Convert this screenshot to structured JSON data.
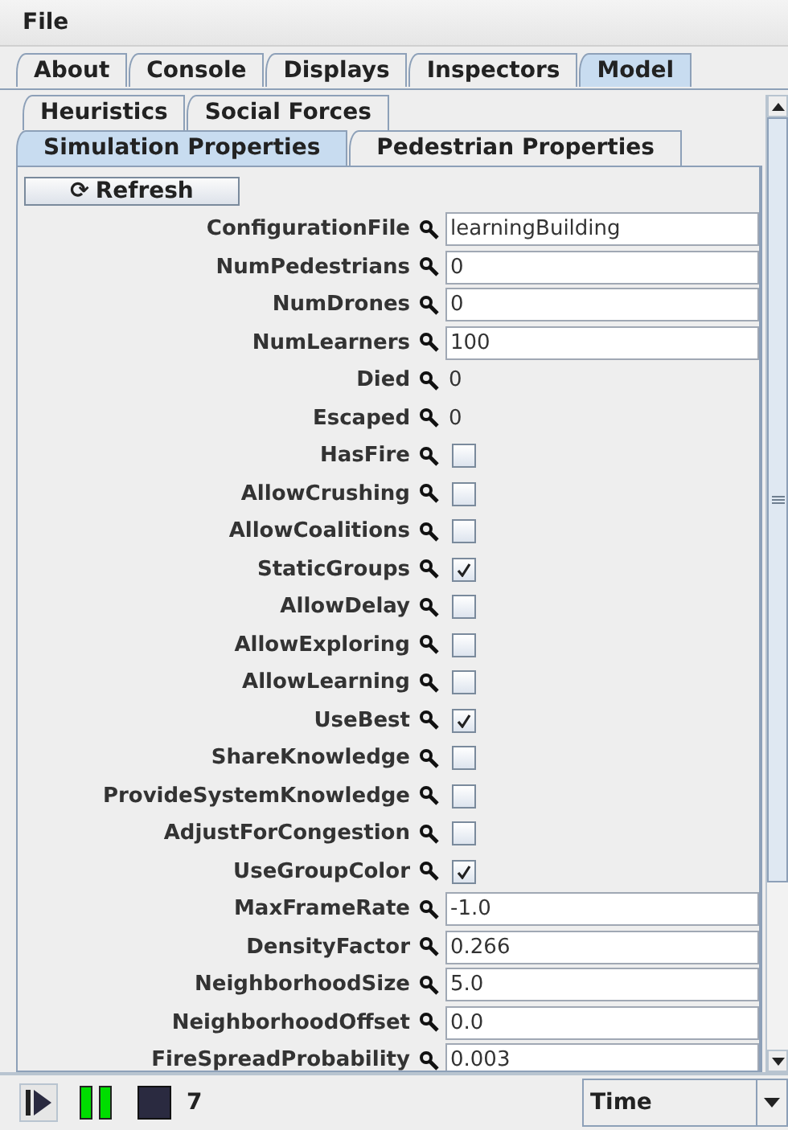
{
  "menu": [
    "File"
  ],
  "tabs": [
    {
      "label": "About",
      "selected": false
    },
    {
      "label": "Console",
      "selected": false
    },
    {
      "label": "Displays",
      "selected": false
    },
    {
      "label": "Inspectors",
      "selected": false
    },
    {
      "label": "Model",
      "selected": true
    }
  ],
  "inner_tab_rows": [
    [
      {
        "label": "Heuristics",
        "selected": false
      },
      {
        "label": "Social Forces",
        "selected": false
      }
    ],
    [
      {
        "label": "Simulation Properties",
        "selected": true
      },
      {
        "label": "Pedestrian Properties",
        "selected": false
      }
    ]
  ],
  "refresh_button": {
    "icon": "⟳",
    "label": "Refresh"
  },
  "properties": [
    {
      "name": "ConfigurationFile",
      "kind": "field",
      "value": "learningBuilding"
    },
    {
      "name": "NumPedestrians",
      "kind": "field",
      "value": "0"
    },
    {
      "name": "NumDrones",
      "kind": "field",
      "value": "0"
    },
    {
      "name": "NumLearners",
      "kind": "field",
      "value": "100"
    },
    {
      "name": "Died",
      "kind": "readout",
      "value": "0"
    },
    {
      "name": "Escaped",
      "kind": "readout",
      "value": "0"
    },
    {
      "name": "HasFire",
      "kind": "checkbox",
      "checked": false
    },
    {
      "name": "AllowCrushing",
      "kind": "checkbox",
      "checked": false
    },
    {
      "name": "AllowCoalitions",
      "kind": "checkbox",
      "checked": false
    },
    {
      "name": "StaticGroups",
      "kind": "checkbox",
      "checked": true
    },
    {
      "name": "AllowDelay",
      "kind": "checkbox",
      "checked": false
    },
    {
      "name": "AllowExploring",
      "kind": "checkbox",
      "checked": false
    },
    {
      "name": "AllowLearning",
      "kind": "checkbox",
      "checked": false
    },
    {
      "name": "UseBest",
      "kind": "checkbox",
      "checked": true
    },
    {
      "name": "ShareKnowledge",
      "kind": "checkbox",
      "checked": false
    },
    {
      "name": "ProvideSystemKnowledge",
      "kind": "checkbox",
      "checked": false
    },
    {
      "name": "AdjustForCongestion",
      "kind": "checkbox",
      "checked": false
    },
    {
      "name": "UseGroupColor",
      "kind": "checkbox",
      "checked": true
    },
    {
      "name": "MaxFrameRate",
      "kind": "field",
      "value": "-1.0"
    },
    {
      "name": "DensityFactor",
      "kind": "field",
      "value": "0.266"
    },
    {
      "name": "NeighborhoodSize",
      "kind": "field",
      "value": "5.0"
    },
    {
      "name": "NeighborhoodOffset",
      "kind": "field",
      "value": "0.0"
    },
    {
      "name": "FireSpreadProbability",
      "kind": "field",
      "value": "0.003"
    }
  ],
  "controls": {
    "steps": "7",
    "time_mode": "Time"
  }
}
